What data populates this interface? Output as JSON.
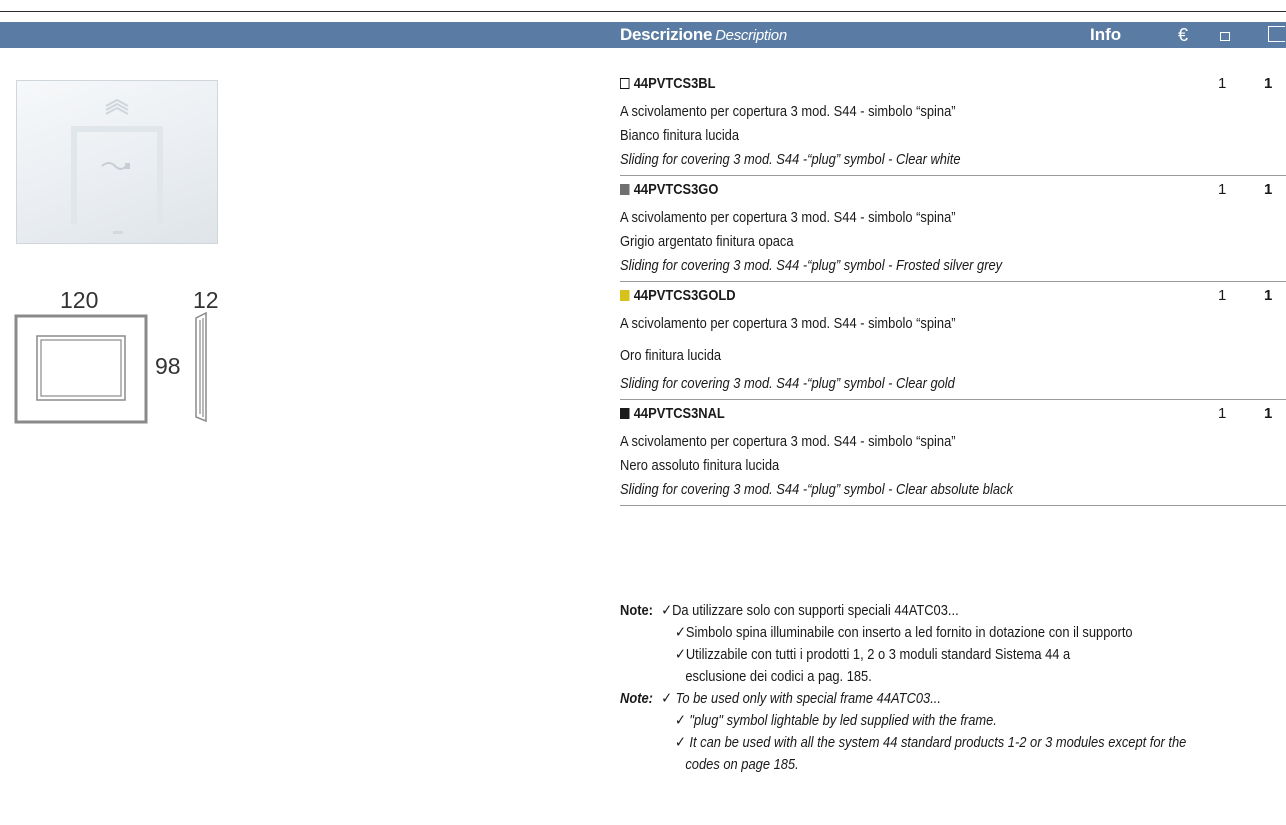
{
  "header": {
    "col_description": "Descrizione",
    "col_description_en": "Description",
    "col_info": "Info",
    "col_price": "€"
  },
  "dimensions": {
    "width": "120",
    "height": "98",
    "depth": "12"
  },
  "items": [
    {
      "code": "44PVTCS3BL",
      "swatch_color": "#ffffff",
      "swatch_border": "#111111",
      "desc_it": "A scivolamento per copertura 3 mod. S44 - simbolo “spina”",
      "finish_it": "Bianco finitura lucida",
      "desc_en": "Sliding for covering 3 mod. S44 -“plug” symbol - Clear white",
      "qty1": "1",
      "qty2": "1"
    },
    {
      "code": "44PVTCS3GO",
      "swatch_color": "#707070",
      "swatch_border": "#707070",
      "desc_it": "A scivolamento per copertura 3 mod. S44 - simbolo “spina”",
      "finish_it": "Grigio argentato finitura opaca",
      "desc_en": "Sliding for covering 3 mod. S44 -“plug” symbol - Frosted silver grey",
      "qty1": "1",
      "qty2": "1"
    },
    {
      "code": "44PVTCS3GOLD",
      "swatch_color": "#d6c21a",
      "swatch_border": "#d6c21a",
      "desc_it": "A scivolamento per copertura 3 mod. S44 - simbolo “spina”",
      "finish_it": " Oro finitura lucida",
      "desc_en": "Sliding for covering 3 mod. S44 -“plug” symbol - Clear gold",
      "qty1": "1",
      "qty2": "1"
    },
    {
      "code": "44PVTCS3NAL",
      "swatch_color": "#1a1a1a",
      "swatch_border": "#1a1a1a",
      "desc_it": "A scivolamento per copertura 3 mod. S44 - simbolo “spina”",
      "finish_it": "Nero assoluto finitura lucida",
      "desc_en": "Sliding for covering 3 mod. S44 -“plug” symbol - Clear absolute black",
      "qty1": "1",
      "qty2": "1"
    }
  ],
  "notes_it": {
    "label": "Note:",
    "lines": [
      "✓Da utilizzare solo con supporti speciali 44ATC03...",
      "✓Simbolo spina illuminabile con inserto a led fornito in dotazione con il supporto",
      "✓Utilizzabile  con  tutti  i  prodotti  1,  2  o  3  moduli  standard  Sistema  44  a",
      "esclusione dei codici a pag. 185."
    ]
  },
  "notes_en": {
    "label": "Note:",
    "lines": [
      "✓ To be used only with special frame 44ATC03...",
      "✓ \"plug\" symbol lightable by led supplied with the frame.",
      "✓ It can be used with all the system 44 standard products 1-2 or 3 modules except for the",
      "codes on page 185."
    ]
  }
}
